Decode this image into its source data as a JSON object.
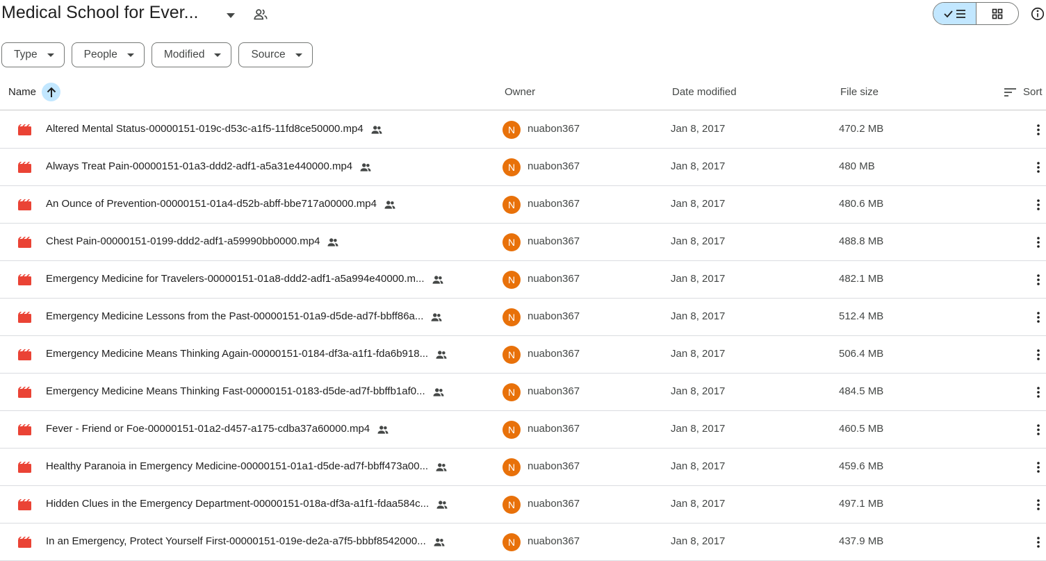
{
  "header": {
    "title": "Medical School for Ever...",
    "colors": {
      "accent_bg": "#c2e7ff",
      "avatar": "#e8710a",
      "video_icon": "#ea4335"
    }
  },
  "filters": [
    {
      "label": "Type"
    },
    {
      "label": "People"
    },
    {
      "label": "Modified"
    },
    {
      "label": "Source"
    }
  ],
  "columns": {
    "name": "Name",
    "owner": "Owner",
    "date": "Date modified",
    "size": "File size",
    "sort": "Sort"
  },
  "files": [
    {
      "name": "Altered Mental Status-00000151-019c-d53c-a1f5-11fd8ce50000.mp4",
      "owner": "nuabon367",
      "avatar": "N",
      "date": "Jan 8, 2017",
      "size": "470.2 MB"
    },
    {
      "name": "Always Treat Pain-00000151-01a3-ddd2-adf1-a5a31e440000.mp4",
      "owner": "nuabon367",
      "avatar": "N",
      "date": "Jan 8, 2017",
      "size": "480 MB"
    },
    {
      "name": "An Ounce of Prevention-00000151-01a4-d52b-abff-bbe717a00000.mp4",
      "owner": "nuabon367",
      "avatar": "N",
      "date": "Jan 8, 2017",
      "size": "480.6 MB"
    },
    {
      "name": "Chest Pain-00000151-0199-ddd2-adf1-a59990bb0000.mp4",
      "owner": "nuabon367",
      "avatar": "N",
      "date": "Jan 8, 2017",
      "size": "488.8 MB"
    },
    {
      "name": "Emergency Medicine for Travelers-00000151-01a8-ddd2-adf1-a5a994e40000.m...",
      "owner": "nuabon367",
      "avatar": "N",
      "date": "Jan 8, 2017",
      "size": "482.1 MB"
    },
    {
      "name": "Emergency Medicine Lessons from the Past-00000151-01a9-d5de-ad7f-bbff86a...",
      "owner": "nuabon367",
      "avatar": "N",
      "date": "Jan 8, 2017",
      "size": "512.4 MB"
    },
    {
      "name": "Emergency Medicine Means Thinking Again-00000151-0184-df3a-a1f1-fda6b918...",
      "owner": "nuabon367",
      "avatar": "N",
      "date": "Jan 8, 2017",
      "size": "506.4 MB"
    },
    {
      "name": "Emergency Medicine Means Thinking Fast-00000151-0183-d5de-ad7f-bbffb1af0...",
      "owner": "nuabon367",
      "avatar": "N",
      "date": "Jan 8, 2017",
      "size": "484.5 MB"
    },
    {
      "name": "Fever - Friend or Foe-00000151-01a2-d457-a175-cdba37a60000.mp4",
      "owner": "nuabon367",
      "avatar": "N",
      "date": "Jan 8, 2017",
      "size": "460.5 MB"
    },
    {
      "name": "Healthy Paranoia in Emergency Medicine-00000151-01a1-d5de-ad7f-bbff473a00...",
      "owner": "nuabon367",
      "avatar": "N",
      "date": "Jan 8, 2017",
      "size": "459.6 MB"
    },
    {
      "name": "Hidden Clues in the Emergency Department-00000151-018a-df3a-a1f1-fdaa584c...",
      "owner": "nuabon367",
      "avatar": "N",
      "date": "Jan 8, 2017",
      "size": "497.1 MB"
    },
    {
      "name": "In an Emergency, Protect Yourself First-00000151-019e-de2a-a7f5-bbbf8542000...",
      "owner": "nuabon367",
      "avatar": "N",
      "date": "Jan 8, 2017",
      "size": "437.9 MB"
    }
  ]
}
